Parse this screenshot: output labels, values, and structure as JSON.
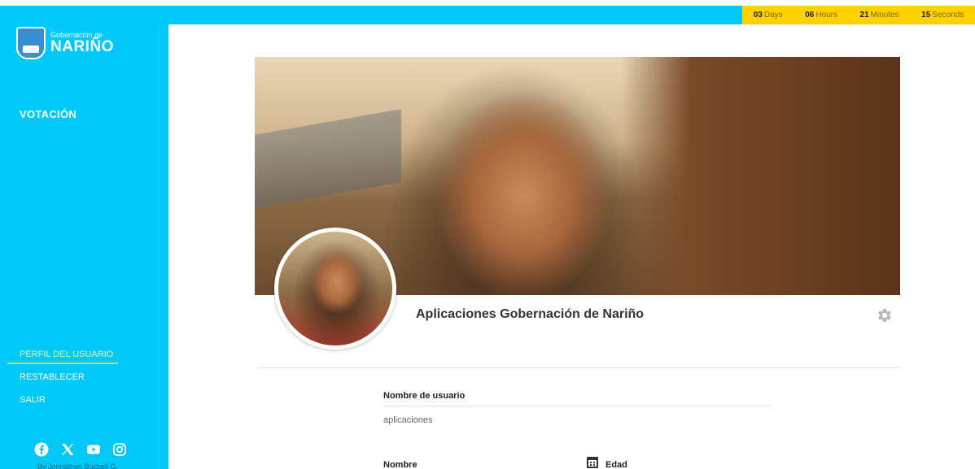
{
  "countdown": [
    {
      "value": "03",
      "unit": "Days"
    },
    {
      "value": "06",
      "unit": "Hours"
    },
    {
      "value": "21",
      "unit": "Minutes"
    },
    {
      "value": "15",
      "unit": "Seconds"
    }
  ],
  "brand": {
    "small": "Gobernación de",
    "big": "NARIÑO"
  },
  "nav": {
    "main": "VOTACIÓN"
  },
  "menu": [
    {
      "label": "PERFIL DEL USUARIO",
      "active": true
    },
    {
      "label": "RESTABLECER",
      "active": false
    },
    {
      "label": "SALIR",
      "active": false
    }
  ],
  "socials": [
    "facebook-icon",
    "x-icon",
    "youtube-icon",
    "instagram-icon"
  ],
  "credit": "By Jonnathan Bucheli G.",
  "profile": {
    "name": "Aplicaciones Gobernación de Nariño",
    "fields": {
      "username_label": "Nombre de usuario",
      "username_value": "aplicaciones",
      "name_label": "Nombre",
      "age_label": "Edad"
    }
  },
  "colors": {
    "primary": "#00c8f8",
    "countdown_bg": "#ffd200",
    "active_menu": "#f3ef9b"
  }
}
